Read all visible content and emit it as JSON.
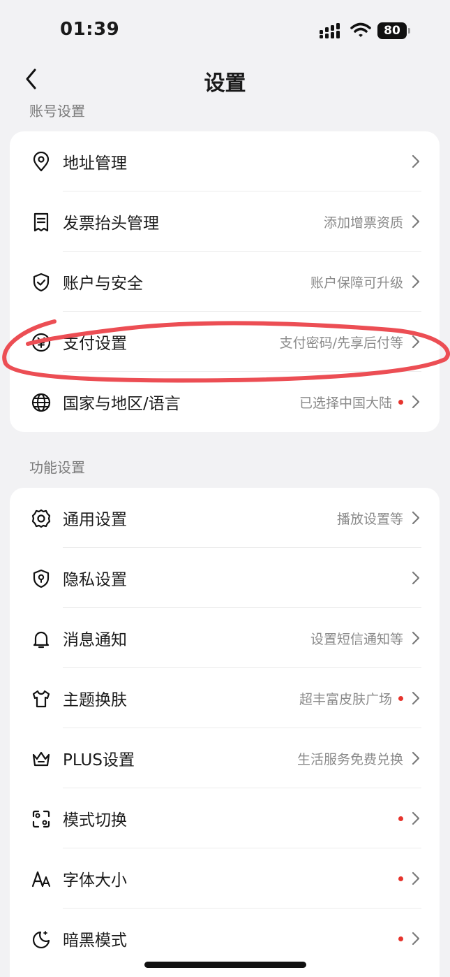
{
  "status_bar": {
    "time": "01:39",
    "battery": "80"
  },
  "nav": {
    "title": "设置"
  },
  "account_section": {
    "header": "账号设置",
    "items": [
      {
        "label": "地址管理",
        "value": "",
        "dot": false,
        "icon": "location-pin-icon"
      },
      {
        "label": "发票抬头管理",
        "value": "添加增票资质",
        "dot": false,
        "icon": "receipt-icon"
      },
      {
        "label": "账户与安全",
        "value": "账户保障可升级",
        "dot": false,
        "icon": "shield-check-icon"
      },
      {
        "label": "支付设置",
        "value": "支付密码/先享后付等",
        "dot": false,
        "icon": "yuan-icon"
      },
      {
        "label": "国家与地区/语言",
        "value": "已选择中国大陆",
        "dot": true,
        "icon": "globe-icon"
      }
    ]
  },
  "function_section": {
    "header": "功能设置",
    "items": [
      {
        "label": "通用设置",
        "value": "播放设置等",
        "dot": false,
        "icon": "gear-icon"
      },
      {
        "label": "隐私设置",
        "value": "",
        "dot": false,
        "icon": "privacy-shield-icon"
      },
      {
        "label": "消息通知",
        "value": "设置短信通知等",
        "dot": false,
        "icon": "bell-icon"
      },
      {
        "label": "主题换肤",
        "value": "超丰富皮肤广场",
        "dot": true,
        "icon": "tshirt-icon"
      },
      {
        "label": "PLUS设置",
        "value": "生活服务免费兑换",
        "dot": false,
        "icon": "crown-icon"
      },
      {
        "label": "模式切换",
        "value": "",
        "dot": true,
        "icon": "switch-mode-icon"
      },
      {
        "label": "字体大小",
        "value": "",
        "dot": true,
        "icon": "font-size-icon"
      },
      {
        "label": "暗黑模式",
        "value": "",
        "dot": true,
        "icon": "moon-icon"
      }
    ]
  },
  "colors": {
    "accent_dot": "#e6342d",
    "annotation": "#ec4e54",
    "background": "#f2f2f4"
  }
}
